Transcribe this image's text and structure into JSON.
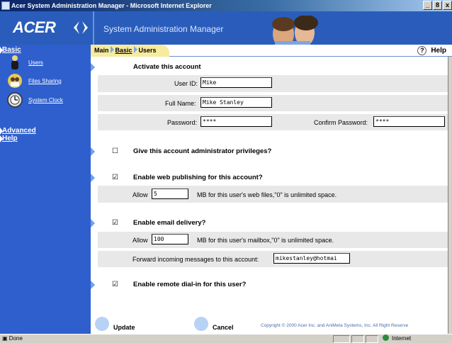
{
  "window": {
    "title": "Acer System Administration Manager - Microsoft Internet Explorer",
    "controls": [
      "_",
      "8",
      "x"
    ]
  },
  "header": {
    "logo": "ACER",
    "app_title": "System Administration Manager"
  },
  "tabs": {
    "main": "Main",
    "basic": "Basic",
    "users": "Users",
    "help": "Help"
  },
  "sidebar": {
    "basic": "Basic",
    "items": [
      {
        "label": "Users",
        "icon": "users-icon"
      },
      {
        "label": "Files Sharing",
        "icon": "files-sharing-icon"
      },
      {
        "label": "System Clock",
        "icon": "clock-icon"
      }
    ],
    "advanced": "Advanced",
    "help": "Help"
  },
  "account": {
    "title": "Activate this account",
    "userid_label": "User ID:",
    "userid_value": "Mike",
    "fullname_label": "Full Name:",
    "fullname_value": "Mike Stanley",
    "password_label": "Password:",
    "password_value": "****",
    "confirm_label": "Confirm Password:",
    "confirm_value": "****"
  },
  "admin": {
    "checked": false,
    "label": "Give this account administrator privileges?"
  },
  "web": {
    "checked": true,
    "label": "Enable web publishing for this account?",
    "allow_label": "Allow",
    "allow_value": "5",
    "note": "MB for this user's web files,\"0\" is unlimited space."
  },
  "email": {
    "checked": true,
    "label": "Enable email delivery?",
    "allow_label": "Allow",
    "allow_value": "100",
    "note": "MB for this user's mailbox,\"0\" is unlimited space.",
    "forward_label": "Forward incoming messages to this account:",
    "forward_value": "mikestanley@hotmai"
  },
  "dialin": {
    "checked": true,
    "label": "Enable remote dial-in for this user?"
  },
  "buttons": {
    "update": "Update",
    "cancel": "Cancel"
  },
  "footer": {
    "copyright": "Copyright © 2000   Acer Inc. and AniMeta Systems, Inc.   All Right Reserve"
  },
  "statusbar": {
    "status": "Done",
    "zone": "Internet"
  },
  "colors": {
    "sidebar": "#2f5fcc",
    "banner": "#2a5dbb",
    "tab": "#f7eb9d",
    "marker": "#6aa2ee"
  }
}
